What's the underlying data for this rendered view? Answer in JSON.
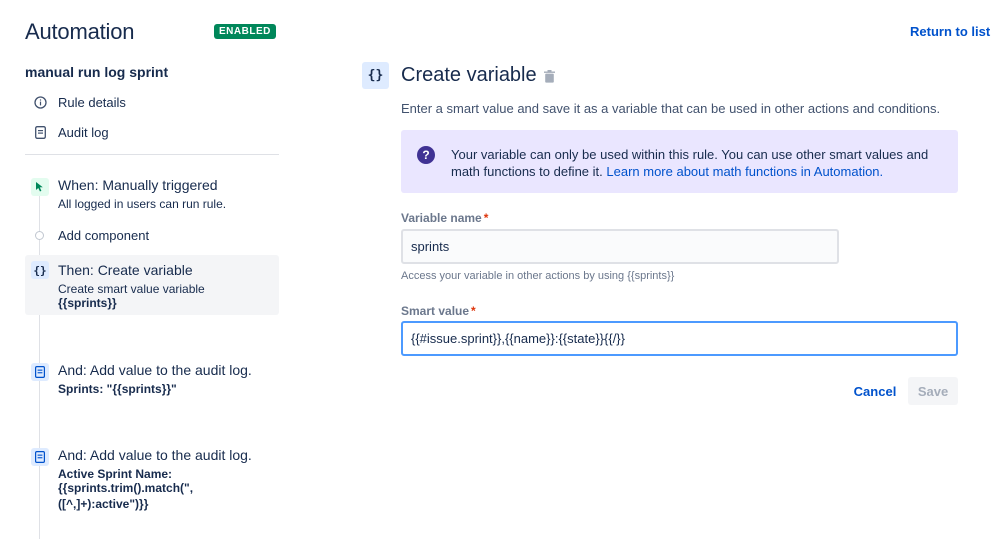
{
  "app": {
    "title": "Automation",
    "status_badge": "ENABLED"
  },
  "rule": {
    "name": "manual run log sprint"
  },
  "nav": {
    "rule_details": "Rule details",
    "audit_log": "Audit log"
  },
  "steps": {
    "trigger": {
      "title": "When: Manually triggered",
      "desc": "All logged in users can run rule."
    },
    "add_component": "Add component",
    "create_variable": {
      "icon_text": "{}",
      "title": "Then: Create variable",
      "desc": "Create smart value variable",
      "desc_bold": "{{sprints}}"
    },
    "audit1": {
      "title": "And: Add value to the audit log.",
      "desc_bold": "Sprints: \"{{sprints}}\""
    },
    "audit2": {
      "title": "And: Add value to the audit log.",
      "desc_bold_1": "Active Sprint Name:",
      "desc_bold_2": "{{sprints.trim().match(\",",
      "desc_bold_3": "([^,]+):active\")}}"
    }
  },
  "header": {
    "return_link": "Return to list"
  },
  "panel": {
    "icon_text": "{}",
    "title": "Create variable",
    "subtitle": "Enter a smart value and save it as a variable that can be used in other actions and conditions.",
    "info_text": "Your variable can only be used within this rule. You can use other smart values and math functions to define it. ",
    "info_link": "Learn more about math functions in Automation.",
    "variable_name_label": "Variable name",
    "variable_name_value": "sprints",
    "variable_helper": "Access your variable in other actions by using {{sprints}}",
    "smart_value_label": "Smart value",
    "smart_value_value": "{{#issue.sprint}},{{name}}:{{state}}{{/}}",
    "required_mark": "*",
    "cancel_label": "Cancel",
    "save_label": "Save"
  },
  "colors": {
    "badge_green": "#00875a",
    "link_blue": "#0052cc",
    "info_bg": "#eae6ff",
    "focus_border": "#4c9aff"
  },
  "icons": {
    "rule_details": "info-circle-icon",
    "audit_log": "document-icon",
    "trigger": "cursor-click-icon",
    "create_variable": "braces-icon",
    "audit_step": "document-icon",
    "delete": "trash-icon",
    "help": "question-circle-icon"
  }
}
